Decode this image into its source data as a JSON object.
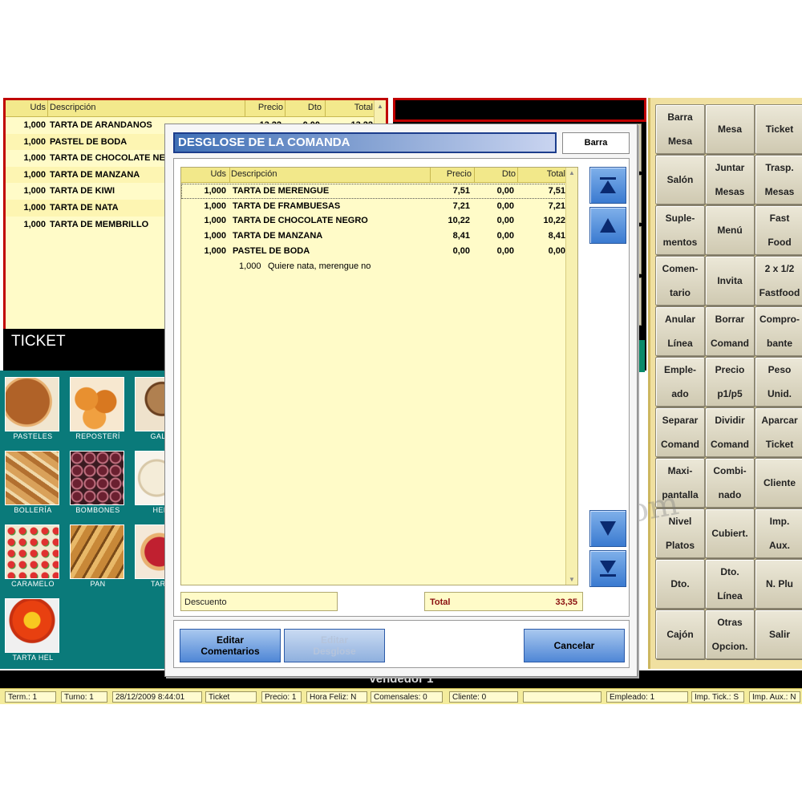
{
  "ticket": {
    "headers": {
      "uds": "Uds",
      "desc": "Descripción",
      "precio": "Precio",
      "dto": "Dto",
      "total": "Total"
    },
    "rows": [
      {
        "qty": "1,000",
        "desc": "TARTA DE ARANDANOS",
        "precio": "13,22",
        "dto": "0,00",
        "total": "13,22"
      },
      {
        "qty": "1,000",
        "desc": "PASTEL DE BODA",
        "precio": "",
        "dto": "",
        "total": ""
      },
      {
        "qty": "1,000",
        "desc": "TARTA DE CHOCOLATE NE",
        "precio": "",
        "dto": "",
        "total": ""
      },
      {
        "qty": "1,000",
        "desc": "TARTA DE MANZANA",
        "precio": "",
        "dto": "",
        "total": ""
      },
      {
        "qty": "1,000",
        "desc": "TARTA DE KIWI",
        "precio": "",
        "dto": "",
        "total": ""
      },
      {
        "qty": "1,000",
        "desc": "TARTA DE NATA",
        "precio": "",
        "dto": "",
        "total": ""
      },
      {
        "qty": "1,000",
        "desc": "TARTA DE MEMBRILLO",
        "precio": "",
        "dto": "",
        "total": ""
      }
    ],
    "label": "TICKET"
  },
  "categories": [
    "PASTELES",
    "REPOSTERÍ",
    "GALLE",
    "BOLLERÍA",
    "BOMBONES",
    "HELA",
    "CARAMELO",
    "PAN",
    "TARTA",
    "TARTA HEL"
  ],
  "functions": [
    "Barra\nMesa",
    "Mesa",
    "Ticket",
    "Salón",
    "Juntar\nMesas",
    "Trasp.\nMesas",
    "Suple-\nmentos",
    "Menú",
    "Fast\nFood",
    "Comen-\ntario",
    "Invita",
    "2 x 1/2\nFastfood",
    "Anular\nLínea",
    "Borrar\nComand",
    "Compro-\nbante",
    "Emple-\nado",
    "Precio\np1/p5",
    "Peso\nUnid.",
    "Separar\nComand",
    "Dividir\nComand",
    "Aparcar\nTicket",
    "Maxi-\npantalla",
    "Combi-\nnado",
    "Cliente",
    "Nivel\nPlatos",
    "Cubiert.",
    "Imp.\nAux.",
    "Dto.",
    "Dto.\nLínea",
    "N. Plu",
    "Cajón",
    "Otras\nOpcion.",
    "Salir"
  ],
  "vendor": "Vendedor 1",
  "status": [
    "Term.: 1",
    "Turno: 1",
    "28/12/2009 8:44:01",
    "Ticket",
    "Precio: 1",
    "Hora Feliz: N",
    "Comensales: 0",
    "Cliente: 0",
    "",
    "Empleado: 1",
    "Imp. Tick.: S",
    "Imp. Aux.: N"
  ],
  "dialog": {
    "title": "DESGLOSE DE LA COMANDA",
    "barra": "Barra",
    "headers": {
      "uds": "Uds",
      "desc": "Descripción",
      "precio": "Precio",
      "dto": "Dto",
      "total": "Total"
    },
    "rows": [
      {
        "qty": "1,000",
        "desc": "TARTA DE MERENGUE",
        "precio": "7,51",
        "dto": "0,00",
        "total": "7,51"
      },
      {
        "qty": "1,000",
        "desc": "TARTA DE FRAMBUESAS",
        "precio": "7,21",
        "dto": "0,00",
        "total": "7,21"
      },
      {
        "qty": "1,000",
        "desc": "TARTA DE CHOCOLATE NEGRO",
        "precio": "10,22",
        "dto": "0,00",
        "total": "10,22"
      },
      {
        "qty": "1,000",
        "desc": "TARTA DE MANZANA",
        "precio": "8,41",
        "dto": "0,00",
        "total": "8,41"
      },
      {
        "qty": "1,000",
        "desc": "PASTEL DE BODA",
        "precio": "0,00",
        "dto": "0,00",
        "total": "0,00"
      }
    ],
    "comment": {
      "qty": "1,000",
      "text": "Quiere nata, merengue no"
    },
    "descuento_label": "Descuento",
    "total_label": "Total",
    "total_value": "33,35",
    "buttons": {
      "edit_comments": "Editar\nComentarios",
      "edit_breakdown": "Editar\nDesglose",
      "cancel": "Cancelar"
    }
  },
  "watermark": "com"
}
